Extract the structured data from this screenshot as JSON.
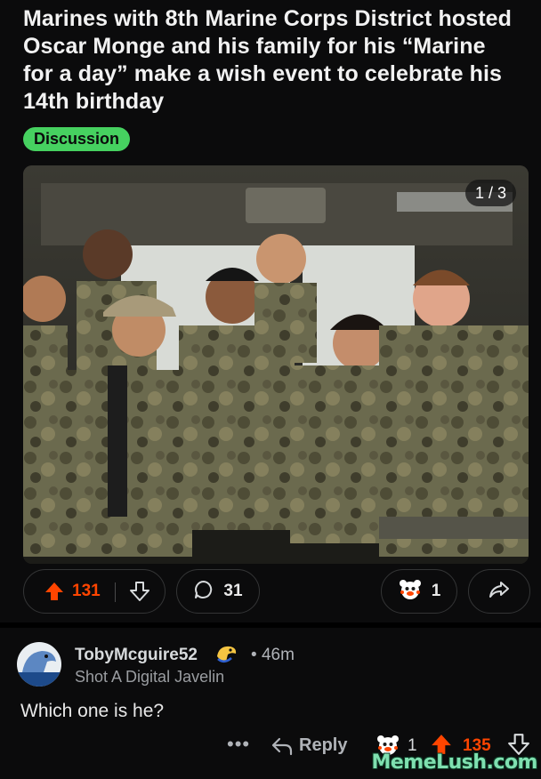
{
  "post": {
    "title": "Marines with 8th Marine Corps District hosted Oscar Monge and his family for his “Marine for a day” make a wish event to celebrate his 14th birthday",
    "flair": "Discussion",
    "flair_color": "#46d160",
    "gallery_counter": "1 / 3",
    "score": "131",
    "comment_count": "31",
    "award_count": "1",
    "accent_color": "#ff4500"
  },
  "comment": {
    "username": "TobyMcguire52",
    "time": "46m",
    "time_separator": "•",
    "tagline": "Shot A Digital Javelin",
    "body": "Which one is he?",
    "more": "•••",
    "reply_label": "Reply",
    "award_count": "1",
    "score": "135"
  },
  "watermark": "MemeLush.com",
  "icons": {
    "upvote": "upvote-arrow-icon",
    "downvote": "downvote-arrow-icon",
    "comments": "speech-bubble-icon",
    "award": "award-icon",
    "share": "share-arrow-icon",
    "reply": "reply-arrow-icon",
    "flair_badge": "dino-badge-icon"
  }
}
